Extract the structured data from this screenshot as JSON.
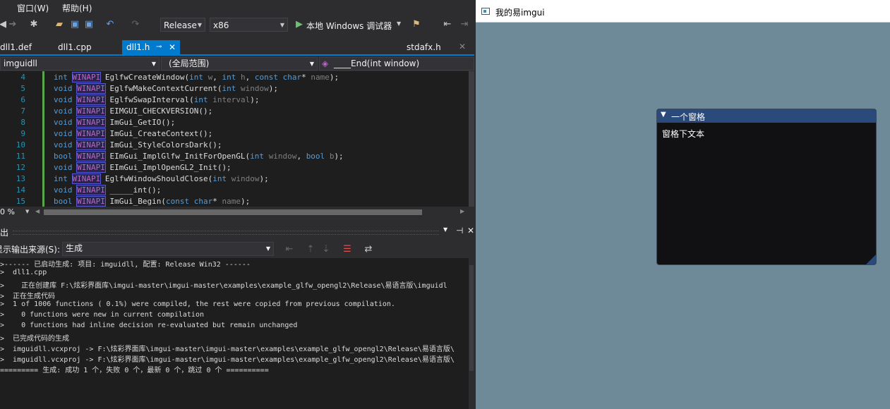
{
  "menu": {
    "window": "窗口(W)",
    "help": "帮助(H)"
  },
  "toolbar": {
    "config": "Release",
    "platform": "x86",
    "run_label": "本地 Windows 调试器"
  },
  "tabs": [
    {
      "label": "dll1.def"
    },
    {
      "label": "dll1.cpp"
    },
    {
      "label": "dll1.h"
    },
    {
      "label": "stdafx.h"
    }
  ],
  "nav": {
    "project": "imguidll",
    "scope": "(全局范围)",
    "member": "____End(int window)"
  },
  "editor": {
    "line_numbers": [
      "4",
      "5",
      "6",
      "7",
      "8",
      "9",
      "10",
      "11",
      "12",
      "13",
      "14",
      "15"
    ],
    "zoom": "0 %"
  },
  "output": {
    "title": "出",
    "source_label": "显示输出来源(S):",
    "source_value": "生成",
    "lines": [
      ">------ 已启动生成: 项目: imguidll, 配置: Release Win32 ------",
      ">  dll1.cpp",
      ">    正在创建库 F:\\炫彩界面库\\imgui-master\\imgui-master\\examples\\example_glfw_opengl2\\Release\\易语言版\\imguidl",
      ">  正在生成代码",
      ">  1 of 1006 functions ( 0.1%) were compiled, the rest were copied from previous compilation.",
      ">    0 functions were new in current compilation",
      ">    0 functions had inline decision re-evaluated but remain unchanged",
      ">  已完成代码的生成",
      ">  imguidll.vcxproj -> F:\\炫彩界面库\\imgui-master\\imgui-master\\examples\\example_glfw_opengl2\\Release\\易语言版\\",
      ">  imguidll.vcxproj -> F:\\炫彩界面库\\imgui-master\\imgui-master\\examples\\example_glfw_opengl2\\Release\\易语言版\\",
      "========= 生成: 成功 1 个，失败 0 个，最新 0 个，跳过 0 个 =========="
    ]
  },
  "app": {
    "title": "我的易imgui",
    "imgui_window_title": "一个窗格",
    "imgui_window_text": "窗格下文本"
  },
  "colors": {
    "accent": "#007acc",
    "imgui_title": "#294a7a",
    "app_bg": "#6e8a99"
  }
}
